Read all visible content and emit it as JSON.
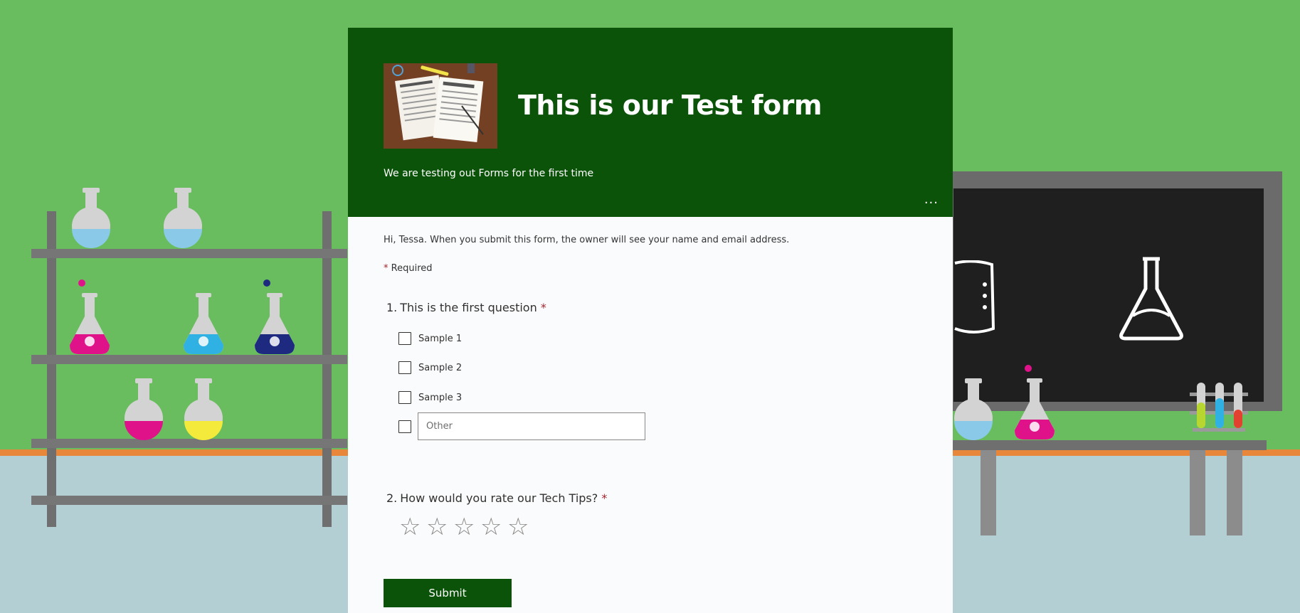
{
  "form": {
    "title": "This is our Test form",
    "subtitle": "We are testing out Forms for the first time",
    "more_label": "...",
    "info_text": "Hi, Tessa. When you submit this form, the owner will see your name and email address.",
    "required_star": "*",
    "required_label": "Required",
    "header_color": "#0b5309",
    "submit_label": "Submit"
  },
  "questions": [
    {
      "number": "1.",
      "title": "This is the first question",
      "required_star": "*",
      "options": [
        {
          "label": "Sample 1"
        },
        {
          "label": "Sample 2"
        },
        {
          "label": "Sample 3"
        }
      ],
      "other_placeholder": "Other"
    },
    {
      "number": "2.",
      "title": "How would you rate our Tech Tips?",
      "required_star": "*",
      "rating_max": 5,
      "rating_value": 0,
      "star_glyph": "☆"
    }
  ],
  "theme": {
    "background": "#6abd5e",
    "accent": "#0b5309",
    "required_color": "#a4262c"
  }
}
